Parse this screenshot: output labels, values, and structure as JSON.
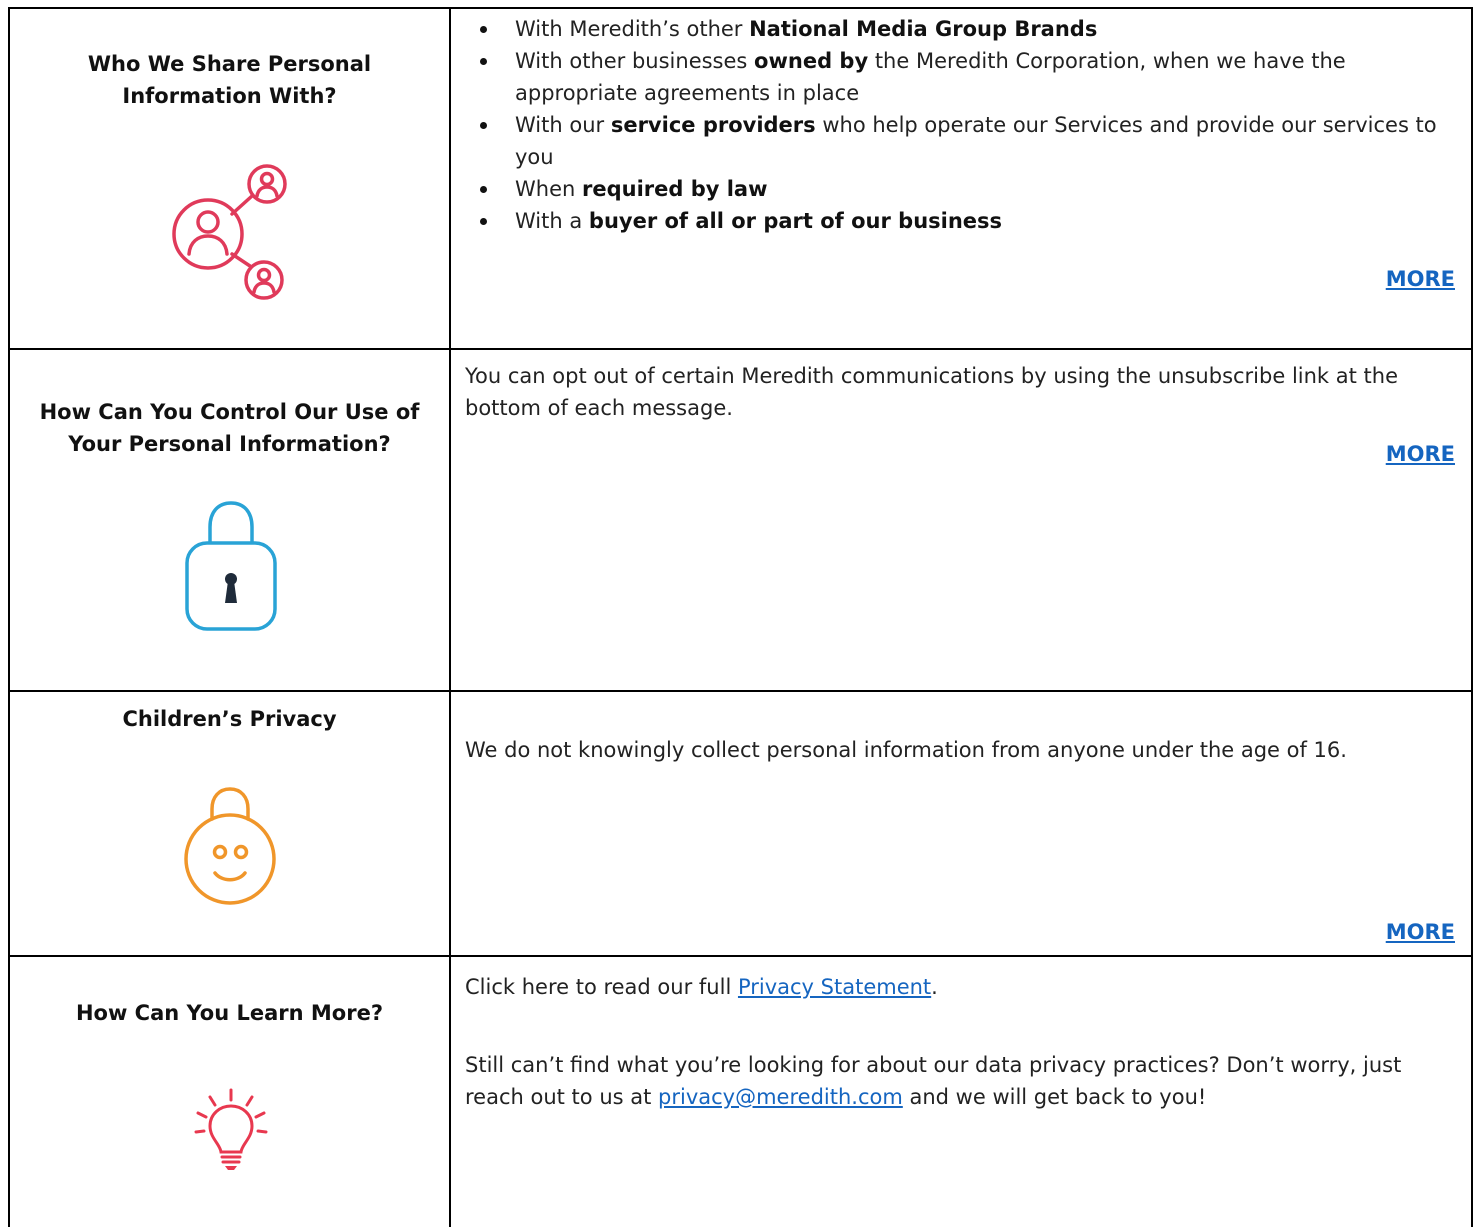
{
  "sections": [
    {
      "heading_line1": "Who We Share Personal",
      "heading_line2": "Information With?",
      "icon": "share-network-icon",
      "bullets": [
        {
          "pre": "With Meredith’s other ",
          "bold": "National Media Group Brands",
          "post": ""
        },
        {
          "pre": "With other businesses ",
          "bold": "owned by",
          "post": " the Meredith Corporation, when we have the appropriate agreements in place"
        },
        {
          "pre": "With our ",
          "bold": "service providers",
          "post": " who help operate our Services and provide our services to you"
        },
        {
          "pre": "When ",
          "bold": "required by law",
          "post": ""
        },
        {
          "pre": "With a ",
          "bold": "buyer of all or part of our business",
          "post": ""
        }
      ],
      "more": "MORE"
    },
    {
      "heading_line1": "How Can You Control Our Use of",
      "heading_line2": "Your Personal Information?",
      "icon": "lock-icon",
      "text": "You can opt out of certain Meredith communications by using the unsubscribe link at the bottom of each message.",
      "more": "MORE"
    },
    {
      "heading_line1": "Children’s Privacy",
      "icon": "smiley-lock-icon",
      "text": "We do not knowingly collect personal information from anyone under the age of 16.",
      "more": "MORE"
    },
    {
      "heading_line1": "How Can You Learn More?",
      "icon": "lightbulb-icon",
      "text1_pre": "Click here to read our full ",
      "text1_link": "Privacy Statement",
      "text1_post": ".",
      "text2_pre": "Still can’t find what you’re looking for about our data privacy practices? Don’t worry, just reach out to us at ",
      "text2_link": "privacy@meredith.com",
      "text2_post": " and we will get back to you!"
    }
  ],
  "colors": {
    "share_icon": "#e03a5a",
    "lock_icon": "#29a3d6",
    "smiley_icon": "#f0962a",
    "bulb_icon": "#e8384f",
    "link": "#1565c0"
  }
}
